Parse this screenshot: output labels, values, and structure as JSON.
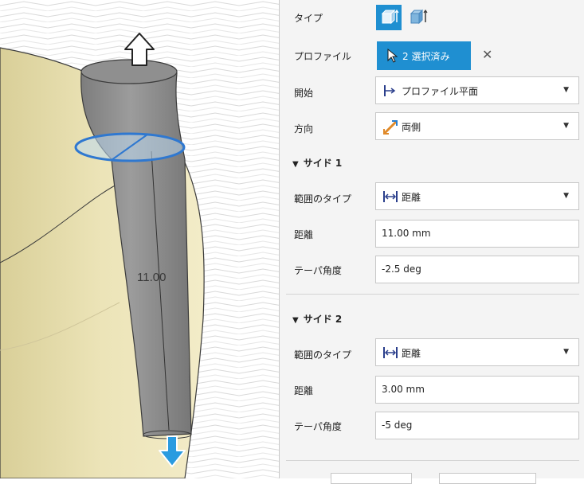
{
  "viewport": {
    "dimension_label": "11.00"
  },
  "panel": {
    "type_label": "タイプ",
    "profile_label": "プロファイル",
    "profile_selected": "2 選択済み",
    "close_symbol": "✕",
    "start_label": "開始",
    "start_value": "プロファイル平面",
    "direction_label": "方向",
    "direction_value": "両側",
    "side1": {
      "title": "サイド 1",
      "extent_type_label": "範囲のタイプ",
      "extent_type_value": "距離",
      "distance_label": "距離",
      "distance_value": "11.00 mm",
      "taper_label": "テーパ角度",
      "taper_value": "-2.5 deg"
    },
    "side2": {
      "title": "サイド 2",
      "extent_type_label": "範囲のタイプ",
      "extent_type_value": "距離",
      "distance_label": "距離",
      "distance_value": "3.00 mm",
      "taper_label": "テーパ角度",
      "taper_value": "-5 deg"
    },
    "collapse_symbol": "▼",
    "dropdown_caret": "▼"
  },
  "colors": {
    "accent": "#1f8fd1",
    "body_surface": "#e9e0b0",
    "extrude_gray": "#8a8a8a",
    "arrow_blue": "#2a9be0"
  }
}
